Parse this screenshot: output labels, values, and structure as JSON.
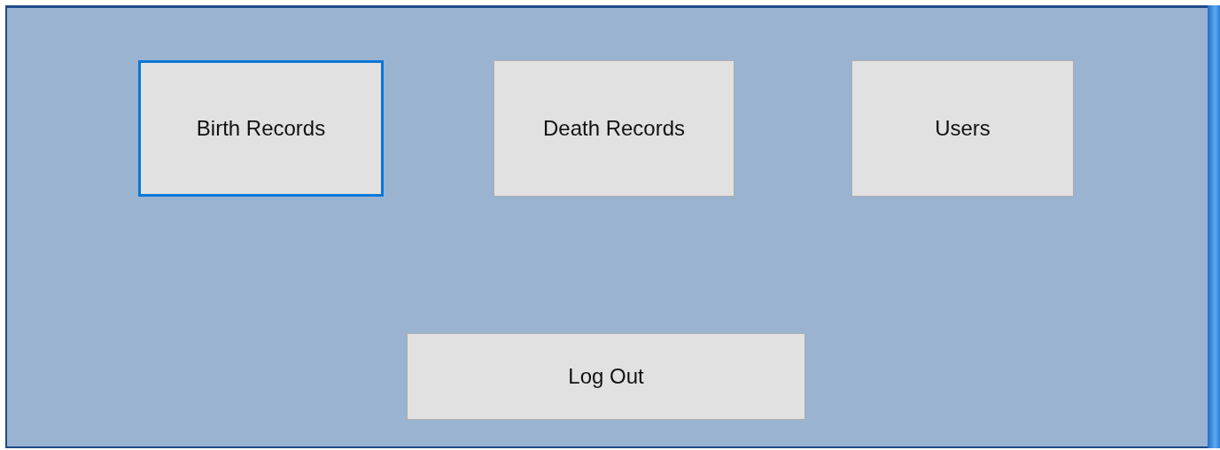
{
  "buttons": [
    {
      "label": "Birth Records",
      "selected": true
    },
    {
      "label": "Death Records",
      "selected": false
    },
    {
      "label": "Users",
      "selected": false
    }
  ],
  "logout_button": {
    "label": "Log Out",
    "selected": false
  }
}
